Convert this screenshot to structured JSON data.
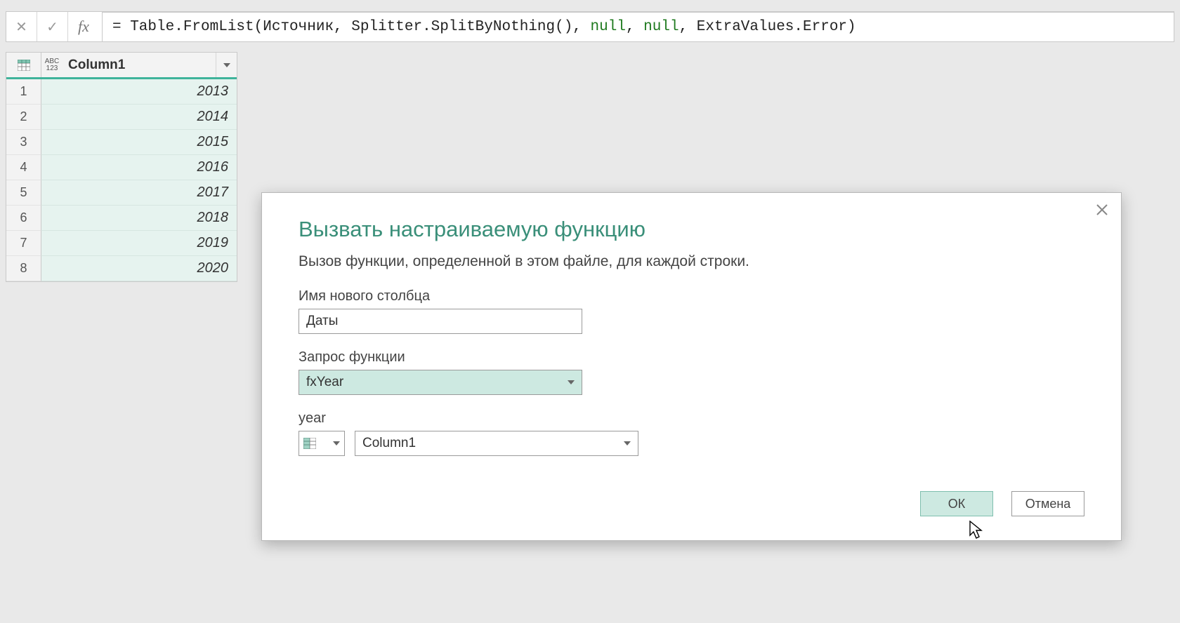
{
  "formula_bar": {
    "cancel_icon": "✕",
    "confirm_icon": "✓",
    "fx_label": "fx",
    "text_part1": "= Table.FromList(Источник, Splitter.SplitByNothing(), ",
    "text_null1": "null",
    "text_comma1": ", ",
    "text_null2": "null",
    "text_part2": ", ExtraValues.Error)"
  },
  "table": {
    "column_type_label_top": "ABC",
    "column_type_label_bottom": "123",
    "column_name": "Column1",
    "rows": [
      {
        "n": "1",
        "v": "2013"
      },
      {
        "n": "2",
        "v": "2014"
      },
      {
        "n": "3",
        "v": "2015"
      },
      {
        "n": "4",
        "v": "2016"
      },
      {
        "n": "5",
        "v": "2017"
      },
      {
        "n": "6",
        "v": "2018"
      },
      {
        "n": "7",
        "v": "2019"
      },
      {
        "n": "8",
        "v": "2020"
      }
    ]
  },
  "dialog": {
    "title": "Вызвать настраиваемую функцию",
    "description": "Вызов функции, определенной в этом файле, для каждой строки.",
    "new_col_label": "Имя нового столбца",
    "new_col_value": "Даты",
    "func_query_label": "Запрос функции",
    "func_query_value": "fxYear",
    "param_label": "year",
    "param_value": "Column1",
    "ok": "ОК",
    "cancel": "Отмена"
  }
}
